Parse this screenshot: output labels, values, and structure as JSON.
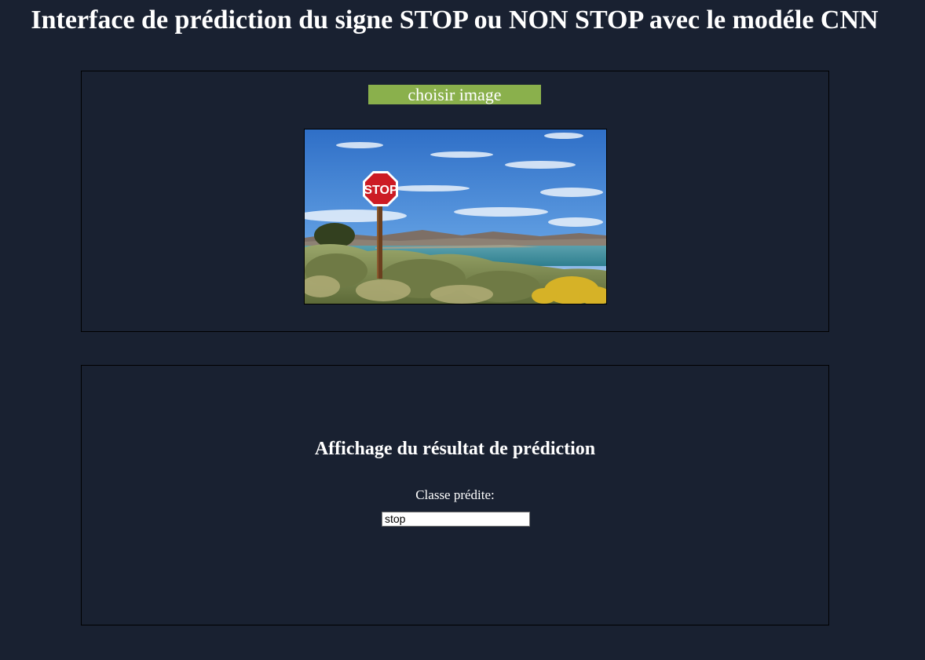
{
  "header": {
    "title": "Interface de prédiction du signe STOP ou NON STOP avec le modéle CNN"
  },
  "upload": {
    "button_label": "choisir image",
    "preview_icon": "stop-sign-landscape-photo",
    "sign_text": "STOP"
  },
  "result": {
    "heading": "Affichage du résultat de prédiction",
    "class_label": "Classe prédite:",
    "class_value": "stop"
  },
  "colors": {
    "background": "#192131",
    "button": "#8ab04c",
    "text": "#ffffff"
  }
}
